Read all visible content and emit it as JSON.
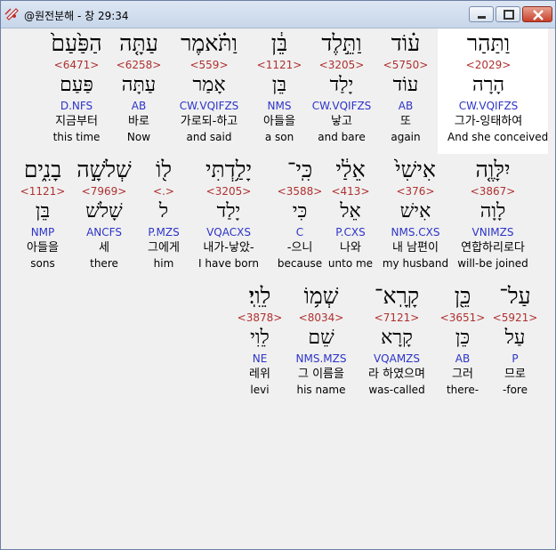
{
  "window": {
    "title": "@원전분해 - 창 29:34",
    "buttons": {
      "minimize": "minimize-icon",
      "maximize": "maximize-icon",
      "close": "close-icon"
    }
  },
  "colors": {
    "strong": "#b03030",
    "parse": "#2d34c8",
    "highlight": "#ffffff",
    "background": "#f0f0f0"
  },
  "rows": [
    {
      "words": [
        {
          "heb": "וַתַּהַר",
          "strong": "<2029>",
          "lemma": "הָרָה",
          "parse": "CW.VQIFZS",
          "kor": "그가-잉태하여",
          "eng": "And she conceived",
          "selected": true
        },
        {
          "heb": "ע֗וֹד",
          "strong": "<5750>",
          "lemma": "עוֹד",
          "parse": "AB",
          "kor": "또",
          "eng": "again"
        },
        {
          "heb": "וַתֵּ֣לֶד",
          "strong": "<3205>",
          "lemma": "יָלַד",
          "parse": "CW.VQIFZS",
          "kor": "낳고",
          "eng": "and bare"
        },
        {
          "heb": "בֵּ֔ן",
          "strong": "<1121>",
          "lemma": "בֵּן",
          "parse": "NMS",
          "kor": "아들을",
          "eng": "a son"
        },
        {
          "heb": "וַתֹּ֗אמֶר",
          "strong": "<559>",
          "lemma": "אָמַר",
          "parse": "CW.VQIFZS",
          "kor": "가로되-하고",
          "eng": "and said"
        },
        {
          "heb": "עַתָּ֤ה",
          "strong": "<6258>",
          "lemma": "עַתָּה",
          "parse": "AB",
          "kor": "바로",
          "eng": "Now"
        },
        {
          "heb": "הַפַּ֙עַם֙",
          "strong": "<6471>",
          "lemma": "פַּעַם",
          "parse": "D.NFS",
          "kor": "지금부터",
          "eng": "this time"
        }
      ]
    },
    {
      "words": [
        {
          "heb": "יִלָּוֶ֤ה",
          "strong": "<3867>",
          "lemma": "לָוָה",
          "parse": "VNIMZS",
          "kor": "연합하리로다",
          "eng": "will-be joined"
        },
        {
          "heb": "אִישִׁי֙",
          "strong": "<376>",
          "lemma": "אִישׁ",
          "parse": "NMS.CXS",
          "kor": "내 남편이",
          "eng": "my husband"
        },
        {
          "heb": "אֵלַ֔י",
          "strong": "<413>",
          "lemma": "אֵל",
          "parse": "P.CXS",
          "kor": "나와",
          "eng": "unto me"
        },
        {
          "heb": "כִּֽי־",
          "strong": "<3588>",
          "lemma": "כִּי",
          "parse": "C",
          "kor": "-으니",
          "eng": "because"
        },
        {
          "heb": "יָלַ֥דְתִּי",
          "strong": "<3205>",
          "lemma": "יָלַד",
          "parse": "VQACXS",
          "kor": "내가-낳았-",
          "eng": "I have born"
        },
        {
          "heb": "ל֖וֹ",
          "strong": "<.>",
          "lemma": "ל",
          "parse": "P.MZS",
          "kor": "그에게",
          "eng": "him"
        },
        {
          "heb": "שְׁלֹשָׁ֣ה",
          "strong": "<7969>",
          "lemma": "שָׁלֹשׁ",
          "parse": "ANCFS",
          "kor": "세",
          "eng": "there"
        },
        {
          "heb": "בָנִ֑ים",
          "strong": "<1121>",
          "lemma": "בֵּן",
          "parse": "NMP",
          "kor": "아들을",
          "eng": "sons"
        }
      ]
    },
    {
      "words": [
        {
          "heb": "עַל־",
          "strong": "<5921>",
          "lemma": "עַל",
          "parse": "P",
          "kor": "므로",
          "eng": "-fore"
        },
        {
          "heb": "כֵּ֖ן",
          "strong": "<3651>",
          "lemma": "כֵּן",
          "parse": "AB",
          "kor": "그러",
          "eng": "there-"
        },
        {
          "heb": "קָרָֽא־",
          "strong": "<7121>",
          "lemma": "קָרָא",
          "parse": "VQAMZS",
          "kor": "라 하였으며",
          "eng": "was-called"
        },
        {
          "heb": "שְׁמ֥וֹ",
          "strong": "<8034>",
          "lemma": "שֵׁם",
          "parse": "NMS.MZS",
          "kor": "그 이름을",
          "eng": "his name"
        },
        {
          "heb": "לֵוִֽי׃",
          "strong": "<3878>",
          "lemma": "לֵוִי",
          "parse": "NE",
          "kor": "레위",
          "eng": "levi"
        }
      ]
    }
  ]
}
